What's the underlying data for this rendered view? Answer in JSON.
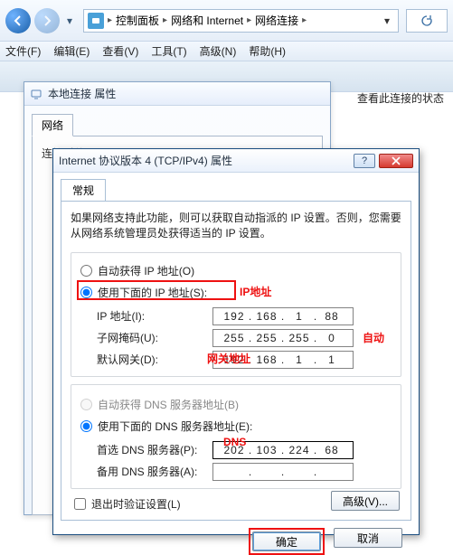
{
  "topbar": {
    "breadcrumb": [
      "控制面板",
      "网络和 Internet",
      "网络连接"
    ]
  },
  "menubar": [
    "文件(F)",
    "编辑(E)",
    "查看(V)",
    "工具(T)",
    "高级(N)",
    "帮助(H)"
  ],
  "status_text": "查看此连接的状态",
  "prop_dialog": {
    "title": "本地连接 属性",
    "tab": "网络",
    "section": "连接时使用:"
  },
  "ipv4_dialog": {
    "title": "Internet 协议版本 4 (TCP/IPv4) 属性",
    "tab": "常规",
    "desc": "如果网络支持此功能，则可以获取自动指派的 IP 设置。否则，您需要从网络系统管理员处获得适当的 IP 设置。",
    "radio_auto_ip": "自动获得 IP 地址(O)",
    "radio_manual_ip": "使用下面的 IP 地址(S):",
    "ip_label": "IP 地址(I):",
    "ip_value": [
      "192",
      "168",
      "1",
      "88"
    ],
    "mask_label": "子网掩码(U):",
    "mask_value": [
      "255",
      "255",
      "255",
      "0"
    ],
    "gw_label": "默认网关(D):",
    "gw_value": [
      "192",
      "168",
      "1",
      "1"
    ],
    "radio_auto_dns": "自动获得 DNS 服务器地址(B)",
    "radio_manual_dns": "使用下面的 DNS 服务器地址(E):",
    "dns1_label": "首选 DNS 服务器(P):",
    "dns1_value": [
      "202",
      "103",
      "224",
      "68"
    ],
    "dns2_label": "备用 DNS 服务器(A):",
    "dns2_value": [
      "",
      "",
      "",
      ""
    ],
    "checkbox": "退出时验证设置(L)",
    "advanced_btn": "高级(V)...",
    "ok": "确定",
    "cancel": "取消",
    "annotations": {
      "ip": "IP地址",
      "auto": "自动",
      "gw": "网关地址",
      "dns": "DNS"
    }
  }
}
